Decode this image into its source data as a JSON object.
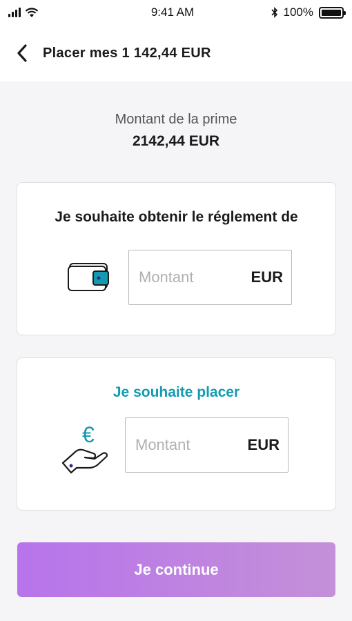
{
  "status_bar": {
    "time": "9:41 AM",
    "battery": "100%",
    "icons": [
      "signal-icon",
      "wifi-icon",
      "bluetooth-icon",
      "battery-icon"
    ]
  },
  "header": {
    "title": "Placer mes 1 142,44 EUR",
    "back_icon": "chevron-left-icon"
  },
  "prime": {
    "label": "Montant de la prime",
    "value": "2142,44 EUR"
  },
  "settlement_card": {
    "title": "Je souhaite obtenir le réglement de",
    "icon": "wallet-icon",
    "input_placeholder": "Montant",
    "currency": "EUR"
  },
  "invest_card": {
    "title": "Je souhaite placer",
    "icon": "euro-hand-icon",
    "input_placeholder": "Montant",
    "currency": "EUR"
  },
  "continue_button": {
    "label": "Je continue"
  },
  "colors": {
    "accent_teal": "#129bb0",
    "button_gradient_start": "#b774eb",
    "button_gradient_end": "#c490d8",
    "icon_purple": "#3c2a7a"
  }
}
